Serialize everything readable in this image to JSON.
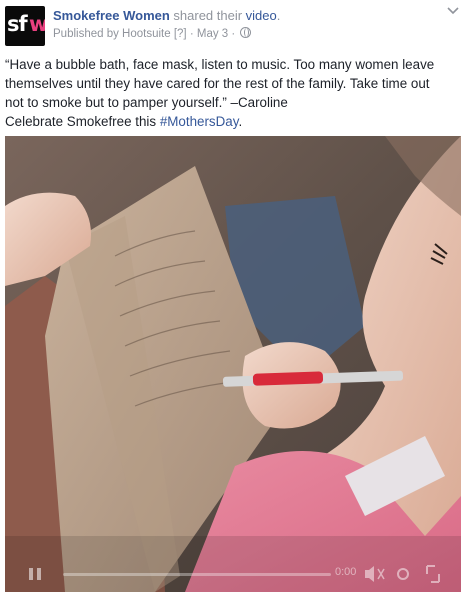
{
  "post": {
    "page_name": "Smokefree Women",
    "action_text": " shared their ",
    "video_link": "video",
    "period": ".",
    "published_by": "Published by Hootsuite",
    "help_marker": "[?]",
    "date": "· May 3 ·",
    "text_lines": [
      "“Have a bubble bath, face mask, listen to music. Too many women leave",
      "themselves until they have cared for the rest of the family. Take time out",
      "not to smoke but to pamper yourself.” –Caroline"
    ],
    "celebrate_prefix": "Celebrate Smokefree this ",
    "hashtag": "#MothersDay",
    "hashtag_suffix": "."
  },
  "video": {
    "time": "0:00"
  },
  "avatar": {
    "letters": "sf",
    "accent_letter": "w"
  },
  "colors": {
    "link": "#365899",
    "meta": "#90949c",
    "accent": "#e8407f"
  }
}
